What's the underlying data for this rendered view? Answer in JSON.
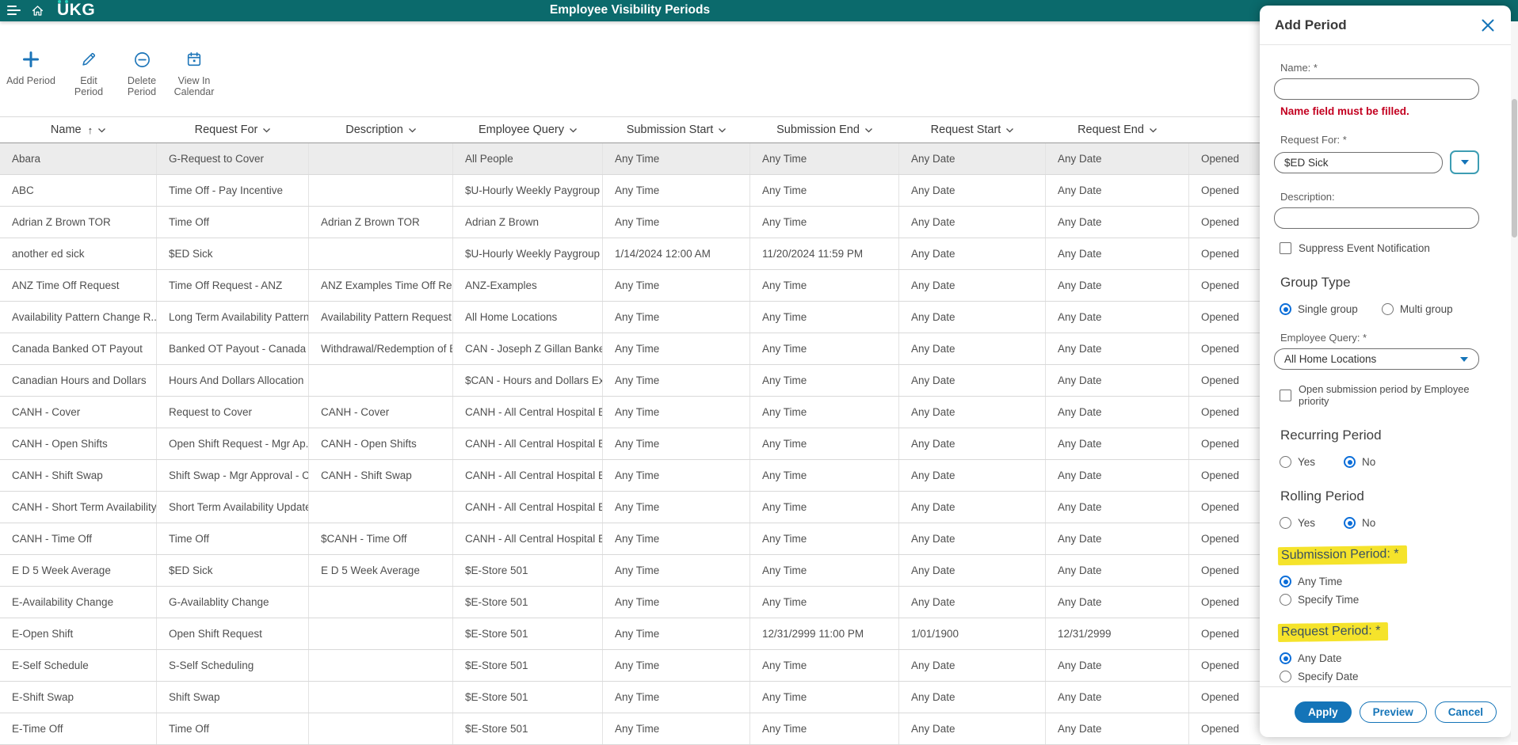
{
  "colors": {
    "teal": "#0B6A6C",
    "accent": "#1474B8",
    "radio": "#0B6ED9",
    "err": "#C30020",
    "hl": "#F5E32B",
    "dot": "#2BD3BE",
    "selrow": "#ECECEC"
  },
  "header": {
    "logo": "UKG",
    "title": "Employee Visibility Periods"
  },
  "toolbar": {
    "buttons": [
      {
        "label": "Add Period",
        "icon": "plus-icon"
      },
      {
        "label": "Edit Period",
        "icon": "pencil-icon"
      },
      {
        "label": "Delete Period",
        "icon": "minus-circle-icon"
      },
      {
        "label": "View In Calendar",
        "icon": "calendar-icon"
      }
    ]
  },
  "table": {
    "selected_row_index": 0,
    "columns": [
      {
        "key": "name",
        "label": "Name",
        "sorted": "asc"
      },
      {
        "key": "request_for",
        "label": "Request For"
      },
      {
        "key": "description",
        "label": "Description"
      },
      {
        "key": "employee_query",
        "label": "Employee Query"
      },
      {
        "key": "submission_start",
        "label": "Submission Start"
      },
      {
        "key": "submission_end",
        "label": "Submission End"
      },
      {
        "key": "request_start",
        "label": "Request Start"
      },
      {
        "key": "request_end",
        "label": "Request End"
      },
      {
        "key": "status",
        "label": ""
      }
    ],
    "rows": [
      [
        "Abara",
        "G-Request to Cover",
        "",
        "All People",
        "Any Time",
        "Any Time",
        "Any Date",
        "Any Date",
        "Opened"
      ],
      [
        "ABC",
        "Time Off - Pay Incentive",
        "",
        "$U-Hourly Weekly Paygroup",
        "Any Time",
        "Any Time",
        "Any Date",
        "Any Date",
        "Opened"
      ],
      [
        "Adrian Z Brown TOR",
        "Time Off",
        "Adrian Z Brown TOR",
        "Adrian Z Brown",
        "Any Time",
        "Any Time",
        "Any Date",
        "Any Date",
        "Opened"
      ],
      [
        "another ed sick",
        "$ED Sick",
        "",
        "$U-Hourly Weekly Paygroup",
        "1/14/2024 12:00 AM",
        "11/20/2024 11:59 PM",
        "Any Date",
        "Any Date",
        "Opened"
      ],
      [
        "ANZ Time Off Request",
        "Time Off Request - ANZ",
        "ANZ Examples Time Off Req...",
        "ANZ-Examples",
        "Any Time",
        "Any Time",
        "Any Date",
        "Any Date",
        "Opened"
      ],
      [
        "Availability Pattern Change R...",
        "Long Term Availability Pattern",
        "Availability Pattern Request -...",
        "All Home Locations",
        "Any Time",
        "Any Time",
        "Any Date",
        "Any Date",
        "Opened"
      ],
      [
        "Canada Banked OT Payout",
        "Banked OT Payout - Canada",
        "Withdrawal/Redemption of B...",
        "CAN - Joseph Z Gillan Banked...",
        "Any Time",
        "Any Time",
        "Any Date",
        "Any Date",
        "Opened"
      ],
      [
        "Canadian Hours and Dollars",
        "Hours And Dollars Allocation",
        "",
        "$CAN - Hours and Dollars Ex...",
        "Any Time",
        "Any Time",
        "Any Date",
        "Any Date",
        "Opened"
      ],
      [
        "CANH - Cover",
        "Request to Cover",
        "CANH - Cover",
        "CANH - All Central Hospital E...",
        "Any Time",
        "Any Time",
        "Any Date",
        "Any Date",
        "Opened"
      ],
      [
        "CANH - Open Shifts",
        "Open Shift Request - Mgr Ap...",
        "CANH - Open Shifts",
        "CANH - All Central Hospital E...",
        "Any Time",
        "Any Time",
        "Any Date",
        "Any Date",
        "Opened"
      ],
      [
        "CANH - Shift Swap",
        "Shift Swap - Mgr Approval - C...",
        "CANH - Shift Swap",
        "CANH - All Central Hospital E...",
        "Any Time",
        "Any Time",
        "Any Date",
        "Any Date",
        "Opened"
      ],
      [
        "CANH - Short Term Availability",
        "Short Term Availability Update",
        "",
        "CANH - All Central Hospital E...",
        "Any Time",
        "Any Time",
        "Any Date",
        "Any Date",
        "Opened"
      ],
      [
        "CANH - Time Off",
        "Time Off",
        "$CANH - Time Off",
        "CANH - All Central Hospital E...",
        "Any Time",
        "Any Time",
        "Any Date",
        "Any Date",
        "Opened"
      ],
      [
        "E D 5 Week Average",
        "$ED Sick",
        "E D 5 Week Average",
        "$E-Store 501",
        "Any Time",
        "Any Time",
        "Any Date",
        "Any Date",
        "Opened"
      ],
      [
        "E-Availability Change",
        "G-Availablity Change",
        "",
        "$E-Store 501",
        "Any Time",
        "Any Time",
        "Any Date",
        "Any Date",
        "Opened"
      ],
      [
        "E-Open Shift",
        "Open Shift Request",
        "",
        "$E-Store 501",
        "Any Time",
        "12/31/2999 11:00 PM",
        "1/01/1900",
        "12/31/2999",
        "Opened"
      ],
      [
        "E-Self Schedule",
        "S-Self Scheduling",
        "",
        "$E-Store 501",
        "Any Time",
        "Any Time",
        "Any Date",
        "Any Date",
        "Opened"
      ],
      [
        "E-Shift Swap",
        "Shift Swap",
        "",
        "$E-Store 501",
        "Any Time",
        "Any Time",
        "Any Date",
        "Any Date",
        "Opened"
      ],
      [
        "E-Time Off",
        "Time Off",
        "",
        "$E-Store 501",
        "Any Time",
        "Any Time",
        "Any Date",
        "Any Date",
        "Opened"
      ]
    ]
  },
  "panel": {
    "title": "Add Period",
    "name_field": {
      "label": "Name: *",
      "value": "",
      "error": "Name field must be filled."
    },
    "request_for": {
      "label": "Request For: *",
      "value": "$ED Sick"
    },
    "description": {
      "label": "Description:",
      "value": ""
    },
    "suppress_event_notification": {
      "label": "Suppress Event Notification",
      "checked": false
    },
    "group_type": {
      "heading": "Group Type",
      "options": [
        {
          "label": "Single group",
          "selected": true
        },
        {
          "label": "Multi group",
          "selected": false
        }
      ]
    },
    "employee_query": {
      "label": "Employee Query: *",
      "value": "All Home Locations"
    },
    "open_submission_priority": {
      "label": "Open submission period by Employee priority",
      "checked": false
    },
    "recurring_period": {
      "heading": "Recurring Period",
      "options": [
        {
          "label": "Yes",
          "selected": false
        },
        {
          "label": "No",
          "selected": true
        }
      ]
    },
    "rolling_period": {
      "heading": "Rolling Period",
      "options": [
        {
          "label": "Yes",
          "selected": false
        },
        {
          "label": "No",
          "selected": true
        }
      ]
    },
    "submission_period": {
      "heading": "Submission Period: *",
      "highlighted": true,
      "options": [
        {
          "label": "Any Time",
          "selected": true
        },
        {
          "label": "Specify Time",
          "selected": false
        }
      ]
    },
    "request_period": {
      "heading": "Request Period: *",
      "highlighted": true,
      "options": [
        {
          "label": "Any Date",
          "selected": true
        },
        {
          "label": "Specify Date",
          "selected": false
        }
      ]
    },
    "footer": {
      "apply_label": "Apply",
      "preview_label": "Preview",
      "cancel_label": "Cancel"
    }
  }
}
